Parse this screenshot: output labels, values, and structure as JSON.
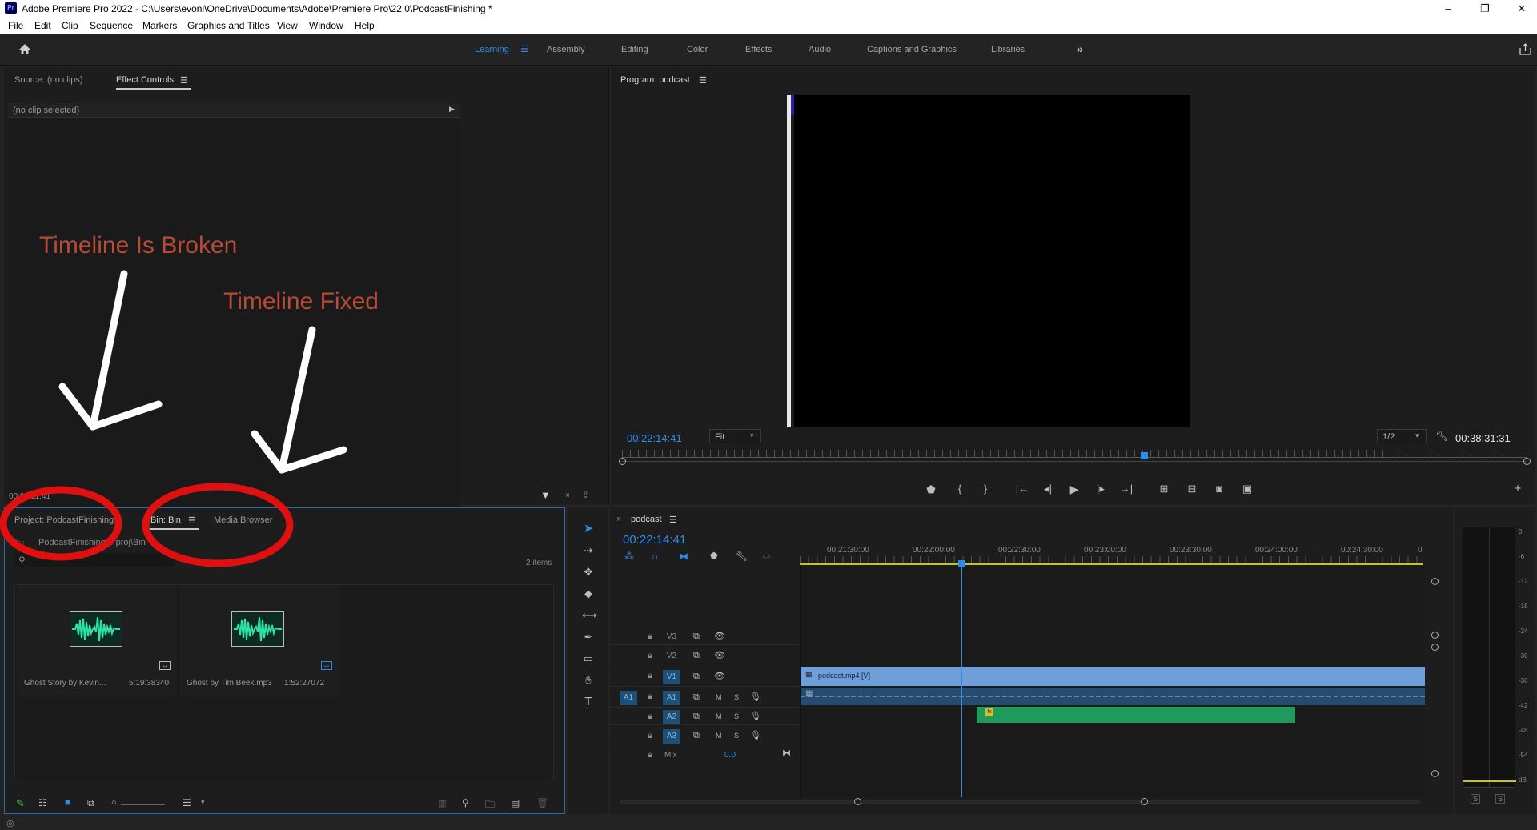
{
  "app": {
    "logo": "Pr",
    "title": "Adobe Premiere Pro 2022 - C:\\Users\\evoni\\OneDrive\\Documents\\Adobe\\Premiere Pro\\22.0\\PodcastFinishing *",
    "window_controls": [
      "–",
      "❐",
      "✕"
    ]
  },
  "menu": [
    "File",
    "Edit",
    "Clip",
    "Sequence",
    "Markers",
    "Graphics and Titles",
    "View",
    "Window",
    "Help"
  ],
  "workspaces": {
    "active": "Learning",
    "items": [
      "Learning",
      "Assembly",
      "Editing",
      "Color",
      "Effects",
      "Audio",
      "Captions and Graphics",
      "Libraries"
    ],
    "more": "»"
  },
  "source_panel": {
    "tabs": [
      "Source: (no clips)",
      "Effect Controls"
    ],
    "active_tab": "Effect Controls",
    "no_clip": "(no clip selected)",
    "timecode_partial": "00:00:11:41"
  },
  "program_monitor": {
    "title": "Program: podcast",
    "timecode": "00:22:14:41",
    "fit": "Fit",
    "resolution": "1/2",
    "duration": "00:38:31:31",
    "playhead_fraction": 0.577
  },
  "project_panel": {
    "tabs": [
      "Project: PodcastFinishing",
      "Bin: Bin",
      "Media Browser"
    ],
    "active_tab": "Bin: Bin",
    "path": "PodcastFinishing.prproj\\Bin",
    "item_count": "2 items",
    "items": [
      {
        "name": "Ghost Story by Kevin...",
        "duration": "5:19:38340"
      },
      {
        "name": "Ghost by Tim Beek.mp3",
        "duration": "1:52:27072"
      }
    ]
  },
  "timeline": {
    "sequence_name": "podcast",
    "close": "×",
    "timecode": "00:22:14:41",
    "ruler": [
      "00:21:30:00",
      "00:22:00:00",
      "00:22:30:00",
      "00:23:00:00",
      "00:23:30:00",
      "00:24:00:00",
      "00:24:30:00",
      "0"
    ],
    "video_tracks": [
      "V3",
      "V2",
      "V1"
    ],
    "audio_tracks": [
      "A1",
      "A2",
      "A3"
    ],
    "source_patch": "A1",
    "mix_label": "Mix",
    "mix_value": "0.0",
    "m": "M",
    "s": "S",
    "video_clip": "podcast.mp4 [V]",
    "audio_fx": "fx"
  },
  "meter": {
    "scale": [
      "0",
      "-6",
      "-12",
      "-18",
      "-24",
      "-30",
      "-36",
      "-42",
      "-48",
      "-54",
      "dB"
    ],
    "solo": [
      "S",
      "S"
    ]
  },
  "annotations": {
    "broken": "Timeline Is Broken",
    "fixed": "Timeline Fixed"
  },
  "colors": {
    "accent_blue": "#2d8ceb",
    "clip_video": "#6f9fd8",
    "clip_audio_green": "#1e9a5a",
    "annotation_red": "#e01010",
    "annotation_text": "#b84a38"
  }
}
